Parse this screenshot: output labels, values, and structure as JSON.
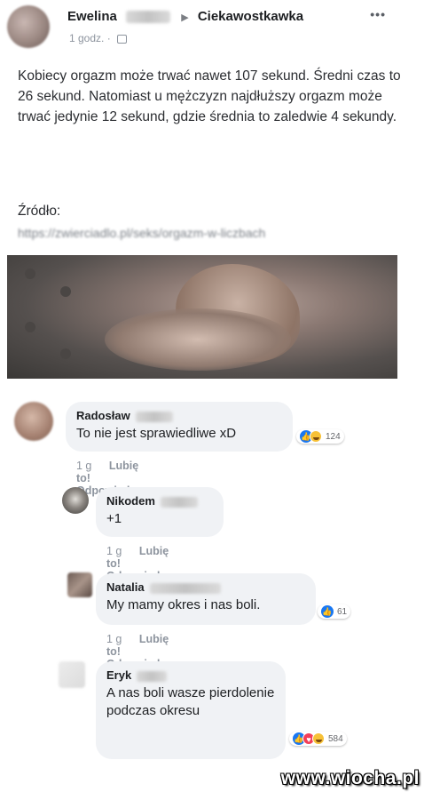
{
  "post": {
    "author": "Ewelina",
    "group": "Ciekawostkawka",
    "time": "1 godz.",
    "body": "Kobiecy orgazm może trwać nawet 107 sekund. Średni czas to 26 sekund. Natomiast u mężczyzn najdłuższy orgazm może trwać jedynie 12 sekund, gdzie średnia to zaledwie 4 sekundy.",
    "source_label": "Źródło:",
    "source_link": "https://zwierciadlo.pl/seks/orgazm-w-liczbach"
  },
  "comments": [
    {
      "name": "Radosław",
      "text": "To nie jest sprawiedliwe xD",
      "time": "1 g",
      "like_label": "Lubię to!",
      "reply_label": "Odpowiedz",
      "reaction_count": "124"
    },
    {
      "name": "Nikodem",
      "text": "+1",
      "time": "1 g",
      "like_label": "Lubię to!",
      "reply_label": "Odpowiedz"
    },
    {
      "name": "Natalia",
      "text": "My mamy okres i nas boli.",
      "time": "1 g",
      "like_label": "Lubię to!",
      "reply_label": "Odpowiedz",
      "reaction_count": "61"
    },
    {
      "name": "Eryk",
      "text": "A nas boli wasze pierdolenie podczas okresu",
      "reaction_count": "584"
    }
  ],
  "watermark": "www.wiocha.pl",
  "colors": {
    "like_blue": "#1877f2",
    "love_red": "#f33e58",
    "haha_yellow": "#f7c137",
    "bubble_gray": "#f0f2f5"
  }
}
